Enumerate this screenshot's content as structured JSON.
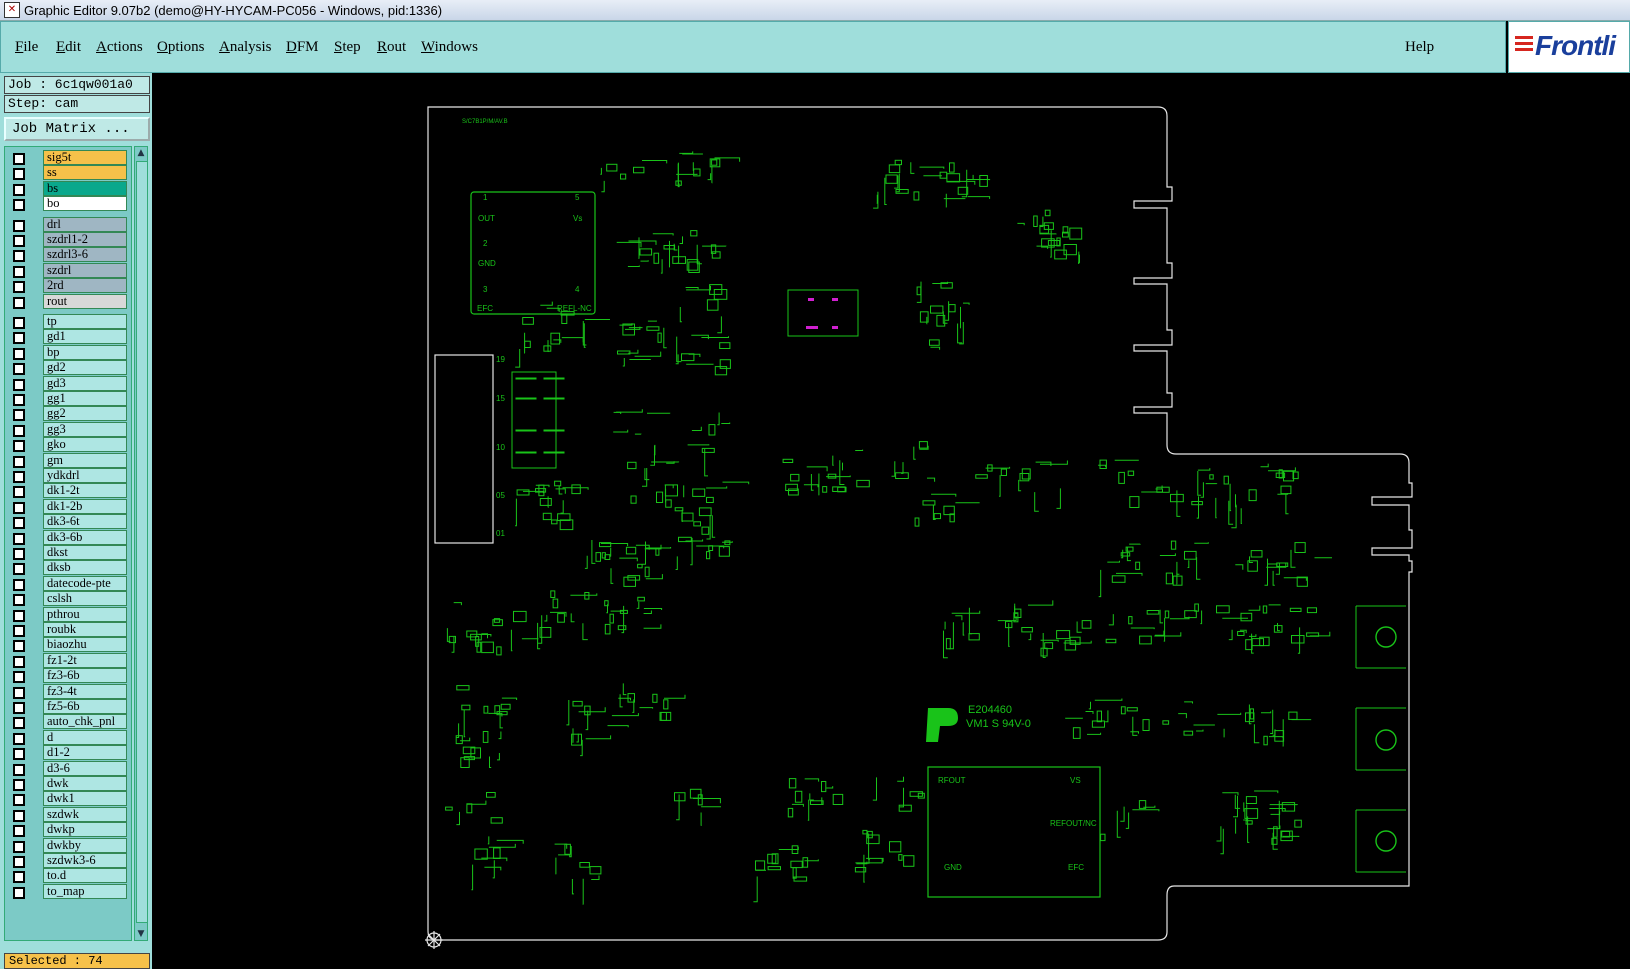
{
  "window": {
    "title": "Graphic Editor 9.07b2 (demo@HY-HYCAM-PC056 - Windows, pid:1336)"
  },
  "menu": {
    "items": [
      "File",
      "Edit",
      "Actions",
      "Options",
      "Analysis",
      "DFM",
      "Step",
      "Rout",
      "Windows"
    ],
    "help": "Help"
  },
  "logo": {
    "text": "Frontli"
  },
  "job": {
    "job_line": "Job : 6c1qw001a0",
    "step_line": "Step: cam",
    "matrix_button": "Job Matrix ..."
  },
  "layers": [
    {
      "name": "sig5t",
      "color": "#f6c14a"
    },
    {
      "name": "ss",
      "color": "#f6c14a"
    },
    {
      "name": "bs",
      "color": "#0aa88c"
    },
    {
      "name": "bo",
      "color": "#ffffff"
    },
    {
      "name": "drl",
      "color": "#9fb6c3"
    },
    {
      "name": "szdrl1-2",
      "color": "#9fb6c3"
    },
    {
      "name": "szdrl3-6",
      "color": "#9fb6c3"
    },
    {
      "name": "szdrl",
      "color": "#9fb6c3"
    },
    {
      "name": "2rd",
      "color": "#9fb6c3"
    },
    {
      "name": "rout",
      "color": "#d8d8d8"
    },
    {
      "name": "tp",
      "color": "#aee6e3"
    },
    {
      "name": "gd1",
      "color": "#aee6e3"
    },
    {
      "name": "bp",
      "color": "#aee6e3"
    },
    {
      "name": "gd2",
      "color": "#aee6e3"
    },
    {
      "name": "gd3",
      "color": "#aee6e3"
    },
    {
      "name": "gg1",
      "color": "#aee6e3"
    },
    {
      "name": "gg2",
      "color": "#aee6e3"
    },
    {
      "name": "gg3",
      "color": "#aee6e3"
    },
    {
      "name": "gko",
      "color": "#aee6e3"
    },
    {
      "name": "gm",
      "color": "#aee6e3"
    },
    {
      "name": "ydkdrl",
      "color": "#aee6e3"
    },
    {
      "name": "dk1-2t",
      "color": "#aee6e3"
    },
    {
      "name": "dk1-2b",
      "color": "#aee6e3"
    },
    {
      "name": "dk3-6t",
      "color": "#aee6e3"
    },
    {
      "name": "dk3-6b",
      "color": "#aee6e3"
    },
    {
      "name": "dkst",
      "color": "#aee6e3"
    },
    {
      "name": "dksb",
      "color": "#aee6e3"
    },
    {
      "name": "datecode-pte",
      "color": "#aee6e3"
    },
    {
      "name": "cslsh",
      "color": "#aee6e3"
    },
    {
      "name": "pthrou",
      "color": "#aee6e3"
    },
    {
      "name": "roubk",
      "color": "#aee6e3"
    },
    {
      "name": "biaozhu",
      "color": "#aee6e3"
    },
    {
      "name": "fz1-2t",
      "color": "#aee6e3"
    },
    {
      "name": "fz3-6b",
      "color": "#aee6e3"
    },
    {
      "name": "fz3-4t",
      "color": "#aee6e3"
    },
    {
      "name": "fz5-6b",
      "color": "#aee6e3"
    },
    {
      "name": "auto_chk_pnl",
      "color": "#aee6e3"
    },
    {
      "name": "d",
      "color": "#aee6e3"
    },
    {
      "name": "d1-2",
      "color": "#aee6e3"
    },
    {
      "name": "d3-6",
      "color": "#aee6e3"
    },
    {
      "name": "dwk",
      "color": "#aee6e3"
    },
    {
      "name": "dwk1",
      "color": "#aee6e3"
    },
    {
      "name": "szdwk",
      "color": "#aee6e3"
    },
    {
      "name": "dwkp",
      "color": "#aee6e3"
    },
    {
      "name": "dwkby",
      "color": "#aee6e3"
    },
    {
      "name": "szdwk3-6",
      "color": "#aee6e3"
    },
    {
      "name": "to.d",
      "color": "#aee6e3"
    },
    {
      "name": "to_map",
      "color": "#aee6e3"
    }
  ],
  "status": {
    "selected": "Selected : 74"
  },
  "board": {
    "trace_color": "#19c319",
    "outline_color": "#e6e6e6",
    "pad_color": "#d020d0",
    "texts": {
      "top_left_tag": "S/C7B1P/M/AV.B",
      "comp1": [
        "1",
        "5",
        "OUT",
        "Vs",
        "2",
        "GND",
        "3",
        "4",
        "EFC",
        "REFL-NC"
      ],
      "conn": [
        "19",
        "15",
        "10",
        "05",
        "01"
      ],
      "marking1": "E204460",
      "marking2": "VM1 S 94V-0",
      "comp2": [
        "RFOUT",
        "VS",
        "REFOUT/NC",
        "GND",
        "EFC"
      ]
    }
  }
}
